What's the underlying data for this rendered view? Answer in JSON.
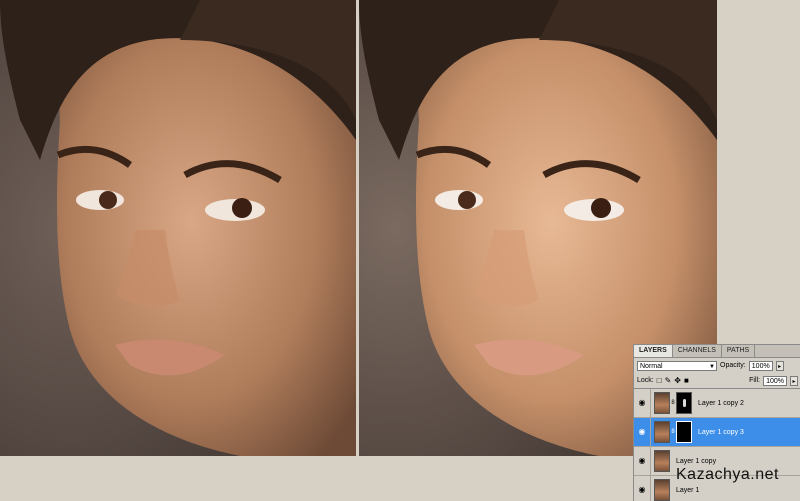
{
  "panel": {
    "tabs": [
      "LAYERS",
      "CHANNELS",
      "PATHS"
    ],
    "blend_mode": "Normal",
    "opacity_label": "Opacity:",
    "opacity_value": "100%",
    "lock_label": "Lock:",
    "fill_label": "Fill:",
    "fill_value": "100%",
    "layers": [
      {
        "name": "Layer 1 copy 2",
        "selected": false,
        "has_mask": true
      },
      {
        "name": "Layer 1 copy 3",
        "selected": true,
        "has_mask": true
      },
      {
        "name": "Layer 1 copy",
        "selected": false,
        "has_mask": false
      },
      {
        "name": "Layer 1",
        "selected": false,
        "has_mask": false
      }
    ]
  },
  "watermark": "Kazachya.net",
  "colors": {
    "background": "#d6d1c4",
    "selection": "#3d8ee8"
  }
}
